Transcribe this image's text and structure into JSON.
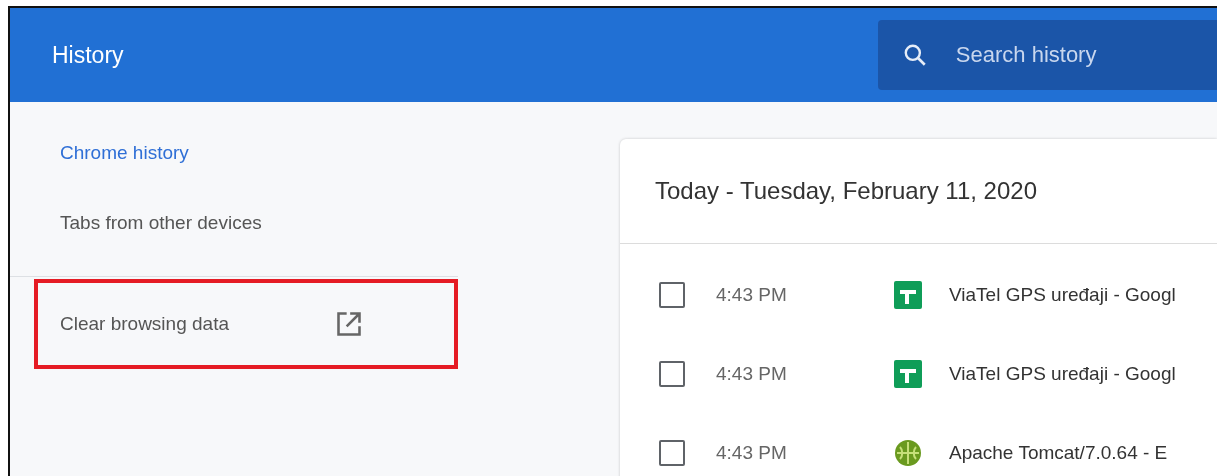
{
  "header": {
    "title": "History",
    "search": {
      "placeholder": "Search history"
    }
  },
  "sidebar": {
    "items": [
      {
        "label": "Chrome history",
        "selected": true
      },
      {
        "label": "Tabs from other devices",
        "selected": false
      }
    ],
    "clear_browsing": {
      "label": "Clear browsing data",
      "highlighted": true
    }
  },
  "history": {
    "date_heading": "Today - Tuesday, February 11, 2020",
    "rows": [
      {
        "checked": false,
        "time": "4:43 PM",
        "kind": "sheets",
        "title": "ViaTel GPS uređaji - Googl"
      },
      {
        "checked": false,
        "time": "4:43 PM",
        "kind": "sheets",
        "title": "ViaTel GPS uređaji - Googl"
      },
      {
        "checked": false,
        "time": "4:43 PM",
        "kind": "globe",
        "title": "Apache Tomcat/7.0.64 - E"
      }
    ]
  }
}
